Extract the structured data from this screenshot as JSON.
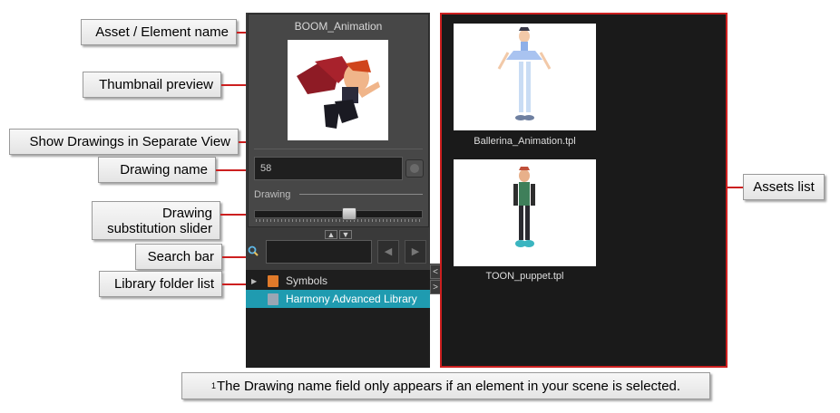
{
  "callouts": {
    "asset_name": "Asset / Element name",
    "thumbnail_preview": "Thumbnail preview",
    "show_drawings": "Show Drawings in Separate View",
    "drawing_name": "Drawing name",
    "slider_line1": "Drawing",
    "slider_line2": "substitution slider",
    "search_bar": "Search bar",
    "folder_list": "Library folder list",
    "assets_list": "Assets list"
  },
  "panel": {
    "asset_name": "BOOM_Animation",
    "drawing_value": "58",
    "drawing_label": "Drawing",
    "slider_value": 0.55
  },
  "folders": [
    {
      "label": "Symbols",
      "icon": "symbols-folder-icon",
      "color": "#e07a2a",
      "selected": false
    },
    {
      "label": "Harmony Advanced Library",
      "icon": "library-folder-icon",
      "color": "#9aa6b4",
      "selected": true
    }
  ],
  "assets": [
    {
      "label": "Ballerina_Animation.tpl"
    },
    {
      "label": "TOON_puppet.tpl"
    }
  ],
  "footnote": {
    "marker": "1",
    "text": "The Drawing name field only appears if an element in your scene is selected."
  },
  "colors": {
    "accent_red": "#cc1f1f",
    "selection": "#1f9bb0",
    "panel_bg": "#3a3a3a"
  }
}
